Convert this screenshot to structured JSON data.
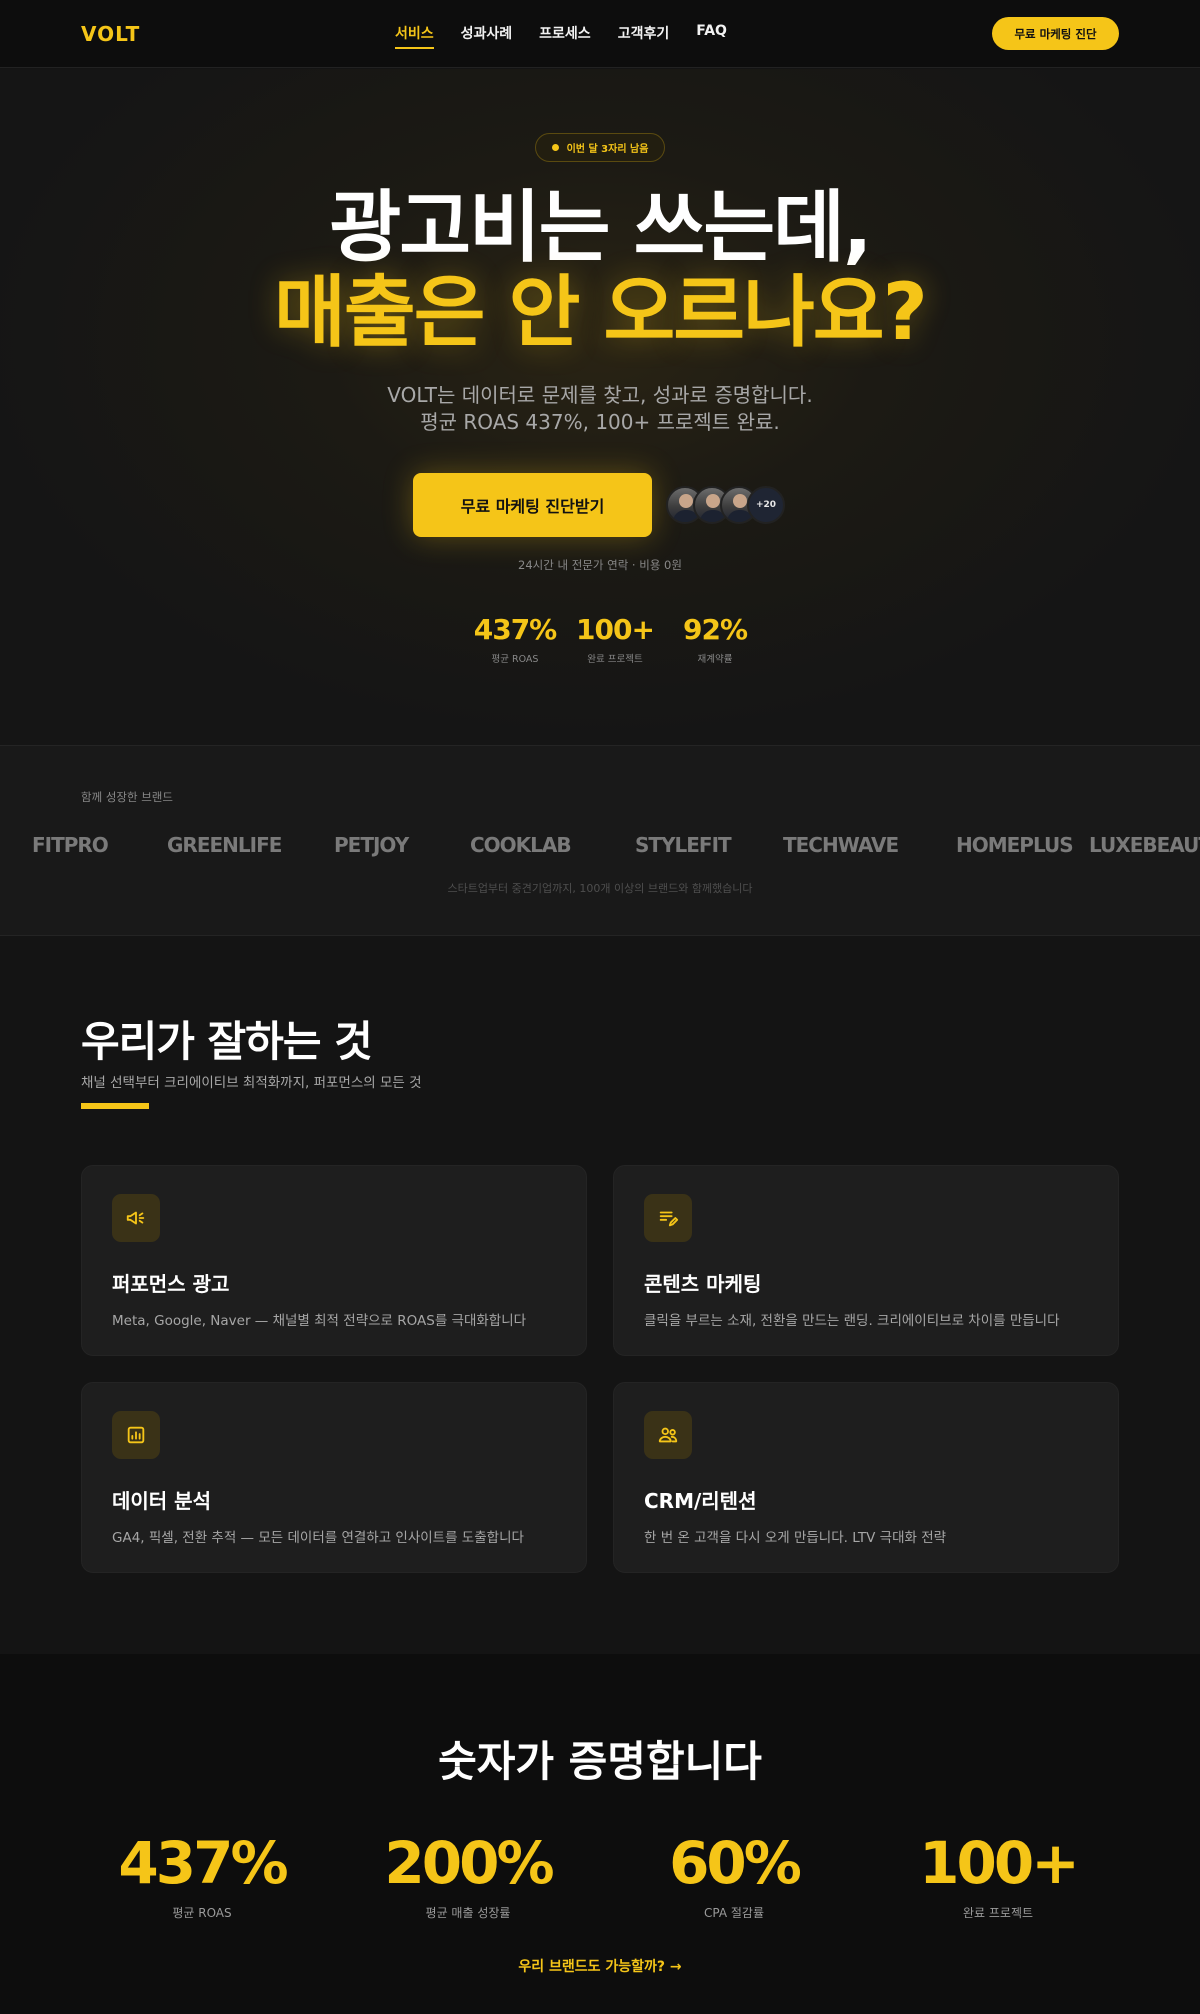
{
  "nav": {
    "logo": "VOLT",
    "items": [
      "서비스",
      "성과사례",
      "프로세스",
      "고객후기",
      "FAQ"
    ],
    "cta": "무료 마케팅 진단"
  },
  "hero": {
    "badge": "이번 달 3자리 남음",
    "headline_1": "광고비는 쓰는데,",
    "headline_2": "매출은 안 오르나요?",
    "sub_1": "VOLT는 데이터로 문제를 찾고, 성과로 증명합니다.",
    "sub_2": "평균 ROAS 437%, 100+ 프로젝트 완료.",
    "cta": "무료 마케팅 진단받기",
    "avatars_more": "+20",
    "note": "24시간 내 전문가 연락 · 비용 0원",
    "stats": [
      {
        "value": "437%",
        "label": "평균 ROAS"
      },
      {
        "value": "100+",
        "label": "완료 프로젝트"
      },
      {
        "value": "92%",
        "label": "재계약률"
      }
    ]
  },
  "brands": {
    "label": "함께 성장한 브랜드",
    "items": [
      "FITPRO",
      "GREENLIFE",
      "PETJOY",
      "COOKLAB",
      "STYLEFIT",
      "TECHWAVE",
      "HOMEPLUS",
      "LUXEBEAUT"
    ],
    "note": "스타트업부터 중견기업까지, 100개 이상의 브랜드와 함께했습니다"
  },
  "services": {
    "title": "우리가 잘하는 것",
    "subtitle": "채널 선택부터 크리에이티브 최적화까지, 퍼포먼스의 모든 것",
    "cards": [
      {
        "icon": "megaphone-icon",
        "title": "퍼포먼스 광고",
        "desc": "Meta, Google, Naver — 채널별 최적 전략으로 ROAS를 극대화합니다"
      },
      {
        "icon": "edit-note-icon",
        "title": "콘텐츠 마케팅",
        "desc": "클릭을 부르는 소재, 전환을 만드는 랜딩. 크리에이티브로 차이를 만듭니다"
      },
      {
        "icon": "bar-chart-icon",
        "title": "데이터 분석",
        "desc": "GA4, 픽셀, 전환 추적 — 모든 데이터를 연결하고 인사이트를 도출합니다"
      },
      {
        "icon": "users-icon",
        "title": "CRM/리텐션",
        "desc": "한 번 온 고객을 다시 오게 만듭니다. LTV 극대화 전략"
      }
    ]
  },
  "stats": {
    "title": "숫자가 증명합니다",
    "items": [
      {
        "value": "437%",
        "label": "평균 ROAS"
      },
      {
        "value": "200%",
        "label": "평균 매출 성장률"
      },
      {
        "value": "60%",
        "label": "CPA 절감률"
      },
      {
        "value": "100+",
        "label": "완료 프로젝트"
      }
    ],
    "link": "우리 브랜드도 가능할까? →"
  },
  "colors": {
    "accent": "#f5c518",
    "background": "#141414",
    "surface": "#1e1e1e"
  }
}
